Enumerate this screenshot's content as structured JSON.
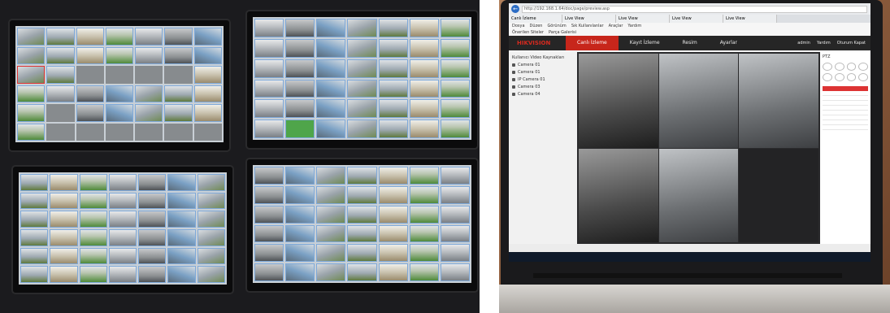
{
  "wall_display": {
    "monitors": [
      {
        "id": "monitor-top-left"
      },
      {
        "id": "monitor-top-right"
      },
      {
        "id": "monitor-bottom-left"
      },
      {
        "id": "monitor-bottom-right"
      }
    ]
  },
  "laptop": {
    "browser": {
      "url": "http://192.168.1.64/doc/page/preview.asp",
      "tabs": [
        "Canlı İzleme",
        "Live View",
        "Live View",
        "Live View",
        "Live View"
      ],
      "menu": [
        "Dosya",
        "Düzen",
        "Görünüm",
        "Sık Kullanılanlar",
        "Araçlar",
        "Yardım"
      ],
      "favorites": [
        "Önerilen Siteler",
        "Parça Galerisi"
      ]
    },
    "app": {
      "logo": "HIKVISION",
      "nav_tabs": [
        "Canlı İzleme",
        "Kayıt İzleme",
        "Resim",
        "Ayarlar"
      ],
      "active_tab": "Canlı İzleme",
      "user_links": [
        "admin",
        "Yardım",
        "Oturum Kapat"
      ],
      "sidebar_title": "Kullanıcı Video Kaynakları",
      "cameras": [
        "Camera 01",
        "Camera 01",
        "IP Camera 01",
        "Camera 03",
        "Camera 04"
      ],
      "ptz_title": "PTZ"
    },
    "colors": {
      "accent": "#c7261b",
      "header": "#262626"
    }
  }
}
